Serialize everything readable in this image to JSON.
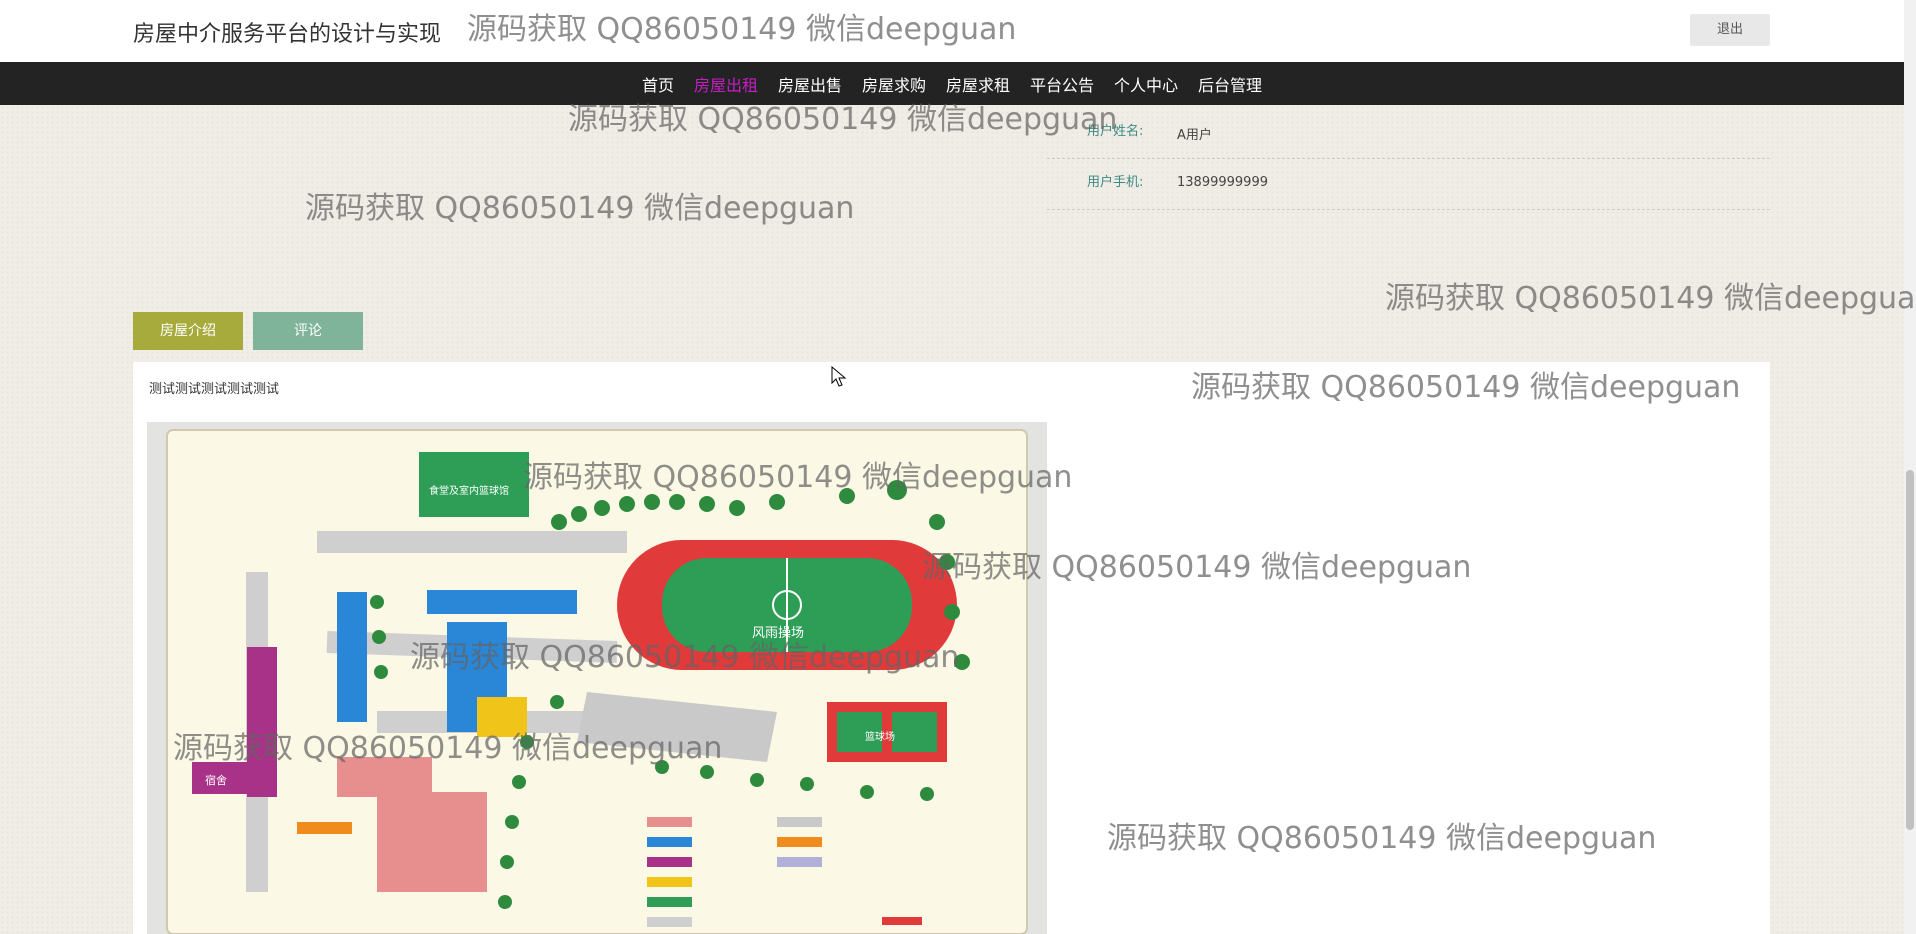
{
  "header": {
    "title": "房屋中介服务平台的设计与实现",
    "logout_label": "退出"
  },
  "nav": {
    "items": [
      {
        "label": "首页",
        "active": false
      },
      {
        "label": "房屋出租",
        "active": true
      },
      {
        "label": "房屋出售",
        "active": false
      },
      {
        "label": "房屋求购",
        "active": false
      },
      {
        "label": "房屋求租",
        "active": false
      },
      {
        "label": "平台公告",
        "active": false
      },
      {
        "label": "个人中心",
        "active": false
      },
      {
        "label": "后台管理",
        "active": false
      }
    ]
  },
  "user_info": {
    "name_label": "用户姓名:",
    "name_value": "A用户",
    "phone_label": "用户手机:",
    "phone_value": "13899999999"
  },
  "tabs": {
    "intro_label": "房屋介绍",
    "comment_label": "评论"
  },
  "content": {
    "text": "测试测试测试测试测试"
  },
  "map": {
    "building_label": "食堂及室内篮球馆",
    "field_label": "风雨操场",
    "court_label": "篮球场",
    "dorm_label": "宿舍"
  },
  "watermark": "源码获取 QQ86050149 微信deepguan",
  "colors": {
    "nav_bg": "#232323",
    "nav_active": "#c41ec5",
    "tab_intro": "#a6ab3c",
    "tab_comment": "#7fb49a",
    "label_color": "#3b8a86"
  }
}
